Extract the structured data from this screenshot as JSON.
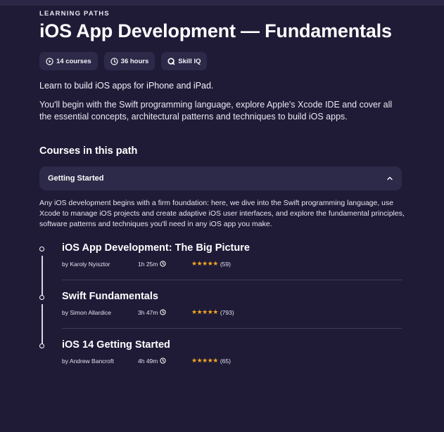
{
  "header": {
    "eyebrow": "LEARNING PATHS",
    "title": "iOS App Development — Fundamentals"
  },
  "pills": [
    {
      "icon": "play-circle-icon",
      "label": "14 courses"
    },
    {
      "icon": "clock-icon",
      "label": "36 hours"
    },
    {
      "icon": "skill-iq-icon",
      "label": "Skill IQ"
    }
  ],
  "lead": "Learn to build iOS apps for iPhone and iPad.",
  "description": "You'll begin with the Swift programming language, explore Apple's Xcode IDE and cover all the essential concepts, architectural patterns and techniques to build iOS apps.",
  "section_heading": "Courses in this path",
  "accordion": {
    "title": "Getting Started",
    "expanded": true,
    "description": "Any iOS development begins with a firm foundation: here, we dive into the Swift programming language, use Xcode to manage iOS projects and create adaptive iOS user interfaces, and explore the fundamental principles, software patterns and techniques you'll need in any iOS app you make."
  },
  "courses": [
    {
      "title": "iOS App Development: The Big Picture",
      "author": "by Karoly Nyisztor",
      "duration": "1h 25m",
      "stars": "★★★★★",
      "rating": 5,
      "reviews": "(59)"
    },
    {
      "title": "Swift Fundamentals",
      "author": "by Simon Allardice",
      "duration": "3h 47m",
      "stars": "★★★★★",
      "rating": 5,
      "reviews": "(793)"
    },
    {
      "title": "iOS 14 Getting Started",
      "author": "by Andrew Bancroft",
      "duration": "4h 49m",
      "stars": "★★★★★",
      "rating": 5,
      "reviews": "(65)"
    }
  ],
  "colors": {
    "background": "#1f1b37",
    "card": "#2d2948",
    "star": "#f5a623"
  }
}
